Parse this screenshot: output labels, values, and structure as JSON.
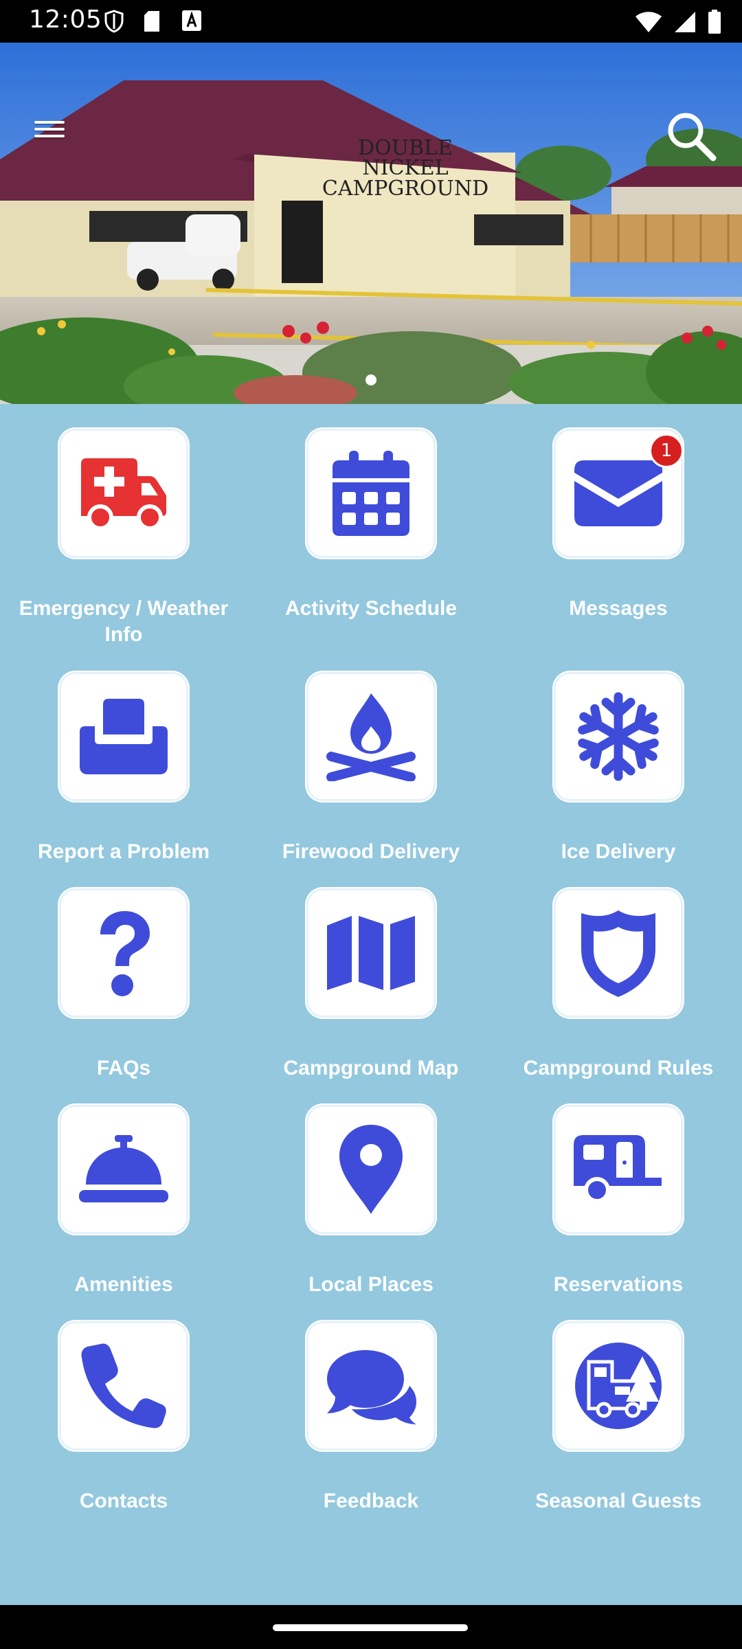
{
  "status_bar": {
    "time": "12:05",
    "left_icons": [
      "shield-icon",
      "sd-card-icon",
      "font-a-icon"
    ],
    "right_icons": [
      "wifi-icon",
      "signal-icon",
      "battery-icon"
    ]
  },
  "header": {
    "menu_icon": "hamburger-menu-icon",
    "search_icon": "search-icon",
    "sign_text": [
      "DOUBLE",
      "NICKEL",
      "CAMPGROUND"
    ],
    "carousel_pages": 1
  },
  "theme": {
    "background": "#93c8df",
    "accent": "#3f4cd9",
    "emergency": "#e63232",
    "label_color": "#ffffff",
    "badge": "#d81f1f"
  },
  "tiles": [
    {
      "label": "Emergency / Weather Info",
      "icon": "ambulance-icon",
      "color": "#e63232"
    },
    {
      "label": "Activity Schedule",
      "icon": "calendar-icon",
      "color": "#3f4cd9"
    },
    {
      "label": "Messages",
      "icon": "envelope-icon",
      "color": "#3f4cd9",
      "badge": "1"
    },
    {
      "label": "Report a Problem",
      "icon": "inbox-tray-icon",
      "color": "#3f4cd9"
    },
    {
      "label": "Firewood Delivery",
      "icon": "campfire-icon",
      "color": "#3f4cd9"
    },
    {
      "label": "Ice Delivery",
      "icon": "snowflake-icon",
      "color": "#3f4cd9"
    },
    {
      "label": "FAQs",
      "icon": "question-mark-icon",
      "color": "#3f4cd9"
    },
    {
      "label": "Campground Map",
      "icon": "folded-map-icon",
      "color": "#3f4cd9"
    },
    {
      "label": "Campground Rules",
      "icon": "shield-badge-icon",
      "color": "#3f4cd9"
    },
    {
      "label": "Amenities",
      "icon": "service-bell-icon",
      "color": "#3f4cd9"
    },
    {
      "label": "Local Places",
      "icon": "map-pin-icon",
      "color": "#3f4cd9"
    },
    {
      "label": "Reservations",
      "icon": "camper-trailer-icon",
      "color": "#3f4cd9"
    },
    {
      "label": "Contacts",
      "icon": "phone-icon",
      "color": "#3f4cd9"
    },
    {
      "label": "Feedback",
      "icon": "chat-bubbles-icon",
      "color": "#3f4cd9"
    },
    {
      "label": "Seasonal Guests",
      "icon": "rv-trees-icon",
      "color": "#3f4cd9"
    }
  ]
}
